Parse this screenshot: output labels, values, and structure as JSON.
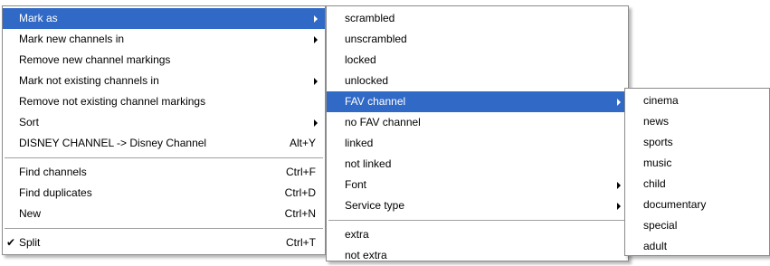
{
  "main_menu": {
    "mark_as": "Mark as",
    "mark_new_channels_in": "Mark new channels in",
    "remove_new_channel_markings": "Remove new channel markings",
    "mark_not_existing_channels_in": "Mark not existing channels in",
    "remove_not_existing_channel_markings": "Remove not existing channel markings",
    "sort": "Sort",
    "rename": {
      "label": "DISNEY CHANNEL -> Disney Channel",
      "shortcut": "Alt+Y"
    },
    "find_channels": {
      "label": "Find channels",
      "shortcut": "Ctrl+F"
    },
    "find_duplicates": {
      "label": "Find duplicates",
      "shortcut": "Ctrl+D"
    },
    "new": {
      "label": "New",
      "shortcut": "Ctrl+N"
    },
    "split": {
      "label": "Split",
      "shortcut": "Ctrl+T",
      "checked": true,
      "check_glyph": "✔"
    }
  },
  "mark_as_menu": {
    "scrambled": "scrambled",
    "unscrambled": "unscrambled",
    "locked": "locked",
    "unlocked": "unlocked",
    "fav_channel": "FAV channel",
    "no_fav_channel": "no FAV channel",
    "linked": "linked",
    "not_linked": "not linked",
    "font": "Font",
    "service_type": "Service type",
    "extra": "extra",
    "not_extra": "not extra"
  },
  "fav_menu": {
    "cinema": "cinema",
    "news": "news",
    "sports": "sports",
    "music": "music",
    "child": "child",
    "documentary": "documentary",
    "special": "special",
    "adult": "adult"
  },
  "colors": {
    "highlight": "#3169c6",
    "highlight_text": "#ffffff",
    "menu_bg": "#ffffff",
    "border": "#8a8a8a"
  },
  "icons": {
    "submenu": "submenu-arrow-icon",
    "check": "checkmark-icon"
  }
}
